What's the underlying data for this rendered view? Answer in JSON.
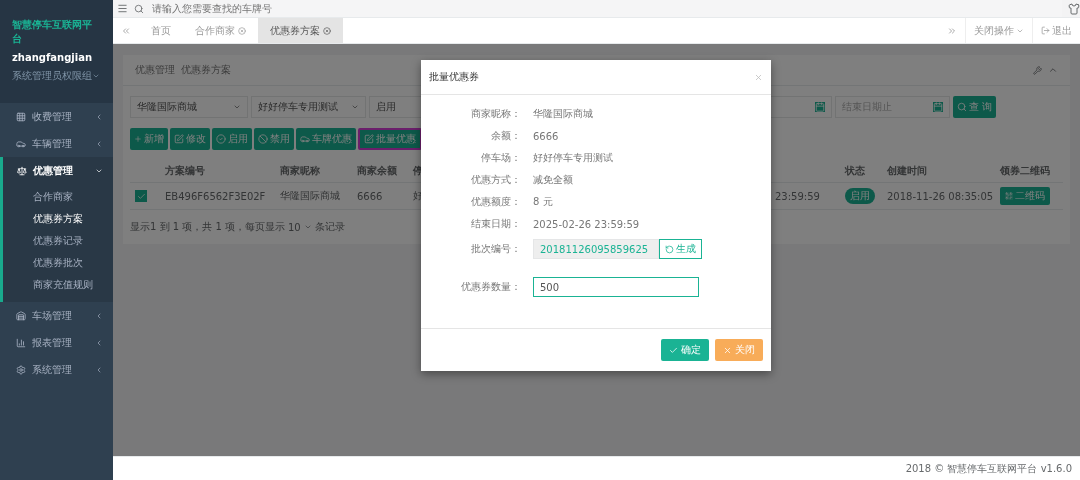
{
  "sidebar": {
    "title": "智慧停车互联网平台",
    "user": "zhangfangjian",
    "role": "系统管理员权限组",
    "items": [
      {
        "label": "收费管理",
        "kind": "grid",
        "expanded": false,
        "selected": false
      },
      {
        "label": "车辆管理",
        "kind": "car",
        "expanded": false,
        "selected": false
      },
      {
        "label": "优惠管理",
        "kind": "scale",
        "expanded": true,
        "selected": true,
        "children": [
          {
            "label": "合作商家",
            "selected": false
          },
          {
            "label": "优惠券方案",
            "selected": true
          },
          {
            "label": "优惠券记录",
            "selected": false
          },
          {
            "label": "优惠券批次",
            "selected": false
          },
          {
            "label": "商家充值规则",
            "selected": false
          }
        ]
      },
      {
        "label": "车场管理",
        "kind": "parking",
        "expanded": false,
        "selected": false
      },
      {
        "label": "报表管理",
        "kind": "chart",
        "expanded": false,
        "selected": false
      },
      {
        "label": "系统管理",
        "kind": "settings",
        "expanded": false,
        "selected": false
      }
    ]
  },
  "search": {
    "placeholder": "请输入您需要查找的车牌号"
  },
  "tabs": [
    {
      "label": "首页",
      "selected": false,
      "closable": false
    },
    {
      "label": "合作商家",
      "selected": false,
      "closable": true
    },
    {
      "label": "优惠券方案",
      "selected": true,
      "closable": true
    }
  ],
  "tab_actions": {
    "close_ops": "关闭操作",
    "logout": "退出"
  },
  "breadcrumb": [
    "优惠管理",
    "优惠券方案"
  ],
  "filters": {
    "merchant": "华隆国际商城",
    "lot": "好好停车专用测试",
    "status": "启用",
    "end_placeholder": "结束日期止",
    "query": "查 询"
  },
  "toolbar": [
    {
      "label": "新增",
      "kind": "add",
      "highlighted": false
    },
    {
      "label": "修改",
      "kind": "edit",
      "highlighted": false
    },
    {
      "label": "启用",
      "kind": "enable",
      "highlighted": false
    },
    {
      "label": "禁用",
      "kind": "disable",
      "highlighted": false
    },
    {
      "label": "车牌优惠",
      "kind": "car",
      "highlighted": false
    },
    {
      "label": "批量优惠",
      "kind": "edit",
      "highlighted": true
    }
  ],
  "table": {
    "columns": [
      "方案编号",
      "商家昵称",
      "商家余额",
      "停",
      "",
      "状态",
      "创建时间",
      "领券二维码"
    ],
    "rows": [
      {
        "checked": true,
        "cells": [
          "EB496F6562F3E02F",
          "华隆国际商城",
          "6666",
          "好",
          "23:59:59"
        ],
        "status": "启用",
        "created": "2018-11-26 08:35:05",
        "qr": "二维码"
      }
    ]
  },
  "pagination": {
    "summary": "显示1 到 1 项，共 1 项，每页显示",
    "page_size": "10",
    "suffix": "条记录"
  },
  "modal": {
    "title": "批量优惠券",
    "fields": [
      {
        "label": "商家昵称：",
        "value": "华隆国际商城"
      },
      {
        "label": "余额：",
        "value": "6666"
      },
      {
        "label": "停车场：",
        "value": "好好停车专用测试"
      },
      {
        "label": "优惠方式：",
        "value": "减免全额"
      },
      {
        "label": "优惠额度：",
        "value": "8 元"
      },
      {
        "label": "结束日期：",
        "value": "2025-02-26 23:59:59"
      }
    ],
    "batch": {
      "label": "批次编号：",
      "value": "20181126095859625",
      "button": "生成"
    },
    "quantity": {
      "label": "优惠券数量：",
      "value": "500"
    },
    "confirm": "确定",
    "close": "关闭"
  },
  "footer": "2018 © 智慧停车互联网平台 v1.6.0"
}
